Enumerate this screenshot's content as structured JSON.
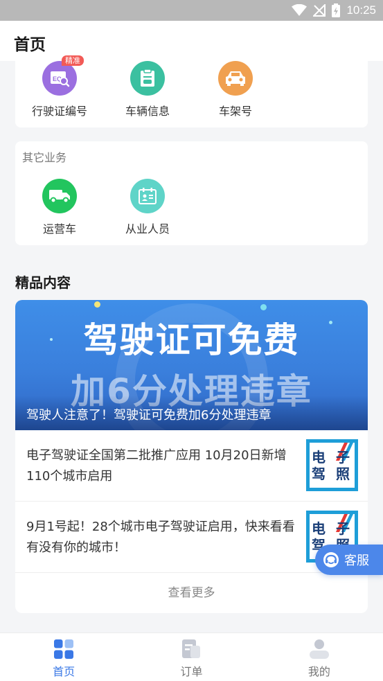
{
  "status_bar": {
    "time": "10:25"
  },
  "header": {
    "title": "首页"
  },
  "top_services": [
    {
      "label": "行驶证编号",
      "icon": "license-card-icon",
      "color": "#9b6fe0",
      "badge": "精准"
    },
    {
      "label": "车辆信息",
      "icon": "clipboard-car-icon",
      "color": "#3bc0a0"
    },
    {
      "label": "车架号",
      "icon": "car-vin-icon",
      "color": "#f0a050"
    }
  ],
  "other_services": {
    "title": "其它业务",
    "items": [
      {
        "label": "运营车",
        "icon": "truck-icon",
        "color": "#22c55e"
      },
      {
        "label": "从业人员",
        "icon": "id-card-icon",
        "color": "#5fd4c8"
      }
    ]
  },
  "featured": {
    "title": "精品内容",
    "banner": {
      "line1": "驾驶证可免费",
      "line2": "加6分处理违章",
      "caption": "驾驶人注意了！驾驶证可免费加6分处理违章"
    },
    "articles": [
      {
        "title": "电子驾驶证全国第二批推广应用 10月20日新增110个城市启用",
        "thumb_line1": "电 子",
        "thumb_line2": "驾 照"
      },
      {
        "title": "9月1号起！28个城市电子驾驶证启用，快来看看有没有你的城市！",
        "thumb_line1": "电 子",
        "thumb_line2": "驾 照"
      }
    ],
    "view_more": "查看更多"
  },
  "floating": {
    "service_label": "客服"
  },
  "tab_bar": {
    "tabs": [
      {
        "label": "首页",
        "icon": "home-grid-icon",
        "active": true
      },
      {
        "label": "订单",
        "icon": "order-doc-icon",
        "active": false
      },
      {
        "label": "我的",
        "icon": "profile-icon",
        "active": false
      }
    ]
  },
  "colors": {
    "accent": "#3a78e6",
    "banner_blue": "#3f8ee8"
  }
}
